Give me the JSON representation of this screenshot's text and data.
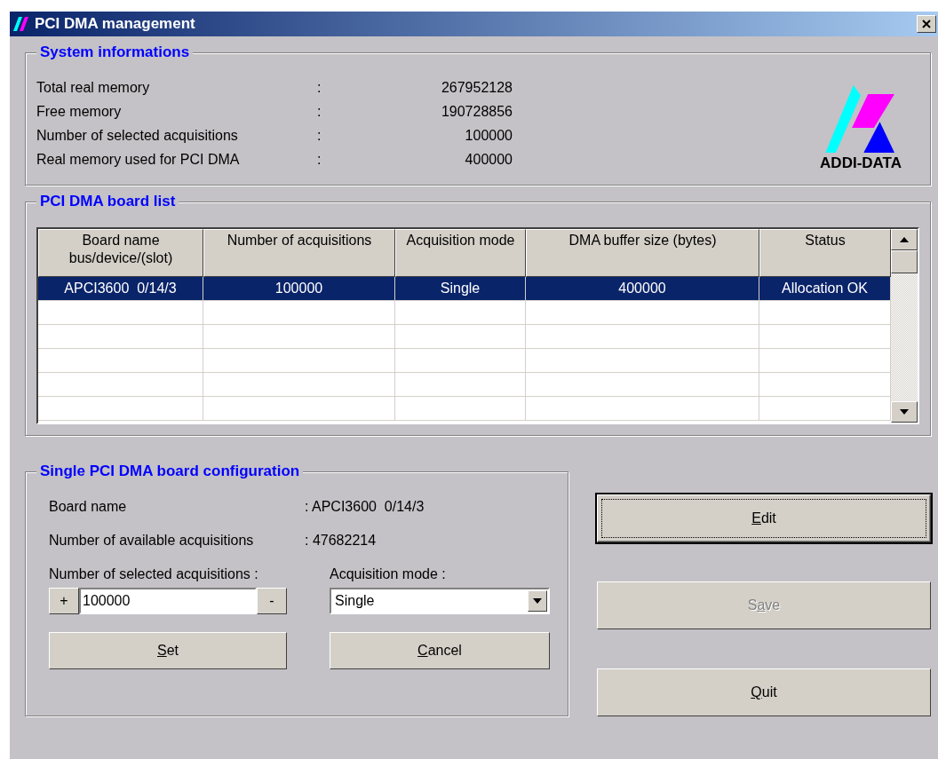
{
  "window": {
    "title": "PCI DMA management"
  },
  "system_info": {
    "title": "System informations",
    "rows": [
      {
        "label": "Total real memory",
        "separator": ":",
        "value": "267952128"
      },
      {
        "label": "Free memory",
        "separator": ":",
        "value": "190728856"
      },
      {
        "label": "Number of selected acquisitions",
        "separator": ":",
        "value": "100000"
      },
      {
        "label": "Real memory used for PCI DMA",
        "separator": ":",
        "value": "400000"
      }
    ],
    "logo": {
      "text": "ADDI-DATA"
    }
  },
  "board_list": {
    "title": "PCI DMA board list",
    "columns": [
      "Board name\nbus/device/(slot)",
      "Number of acquisitions",
      "Acquisition mode",
      "DMA buffer size (bytes)",
      "Status"
    ],
    "rows": [
      {
        "cells": [
          "APCI3600  0/14/3",
          "100000",
          "Single",
          "400000",
          "Allocation OK"
        ],
        "selected": true
      }
    ]
  },
  "config": {
    "title": "Single PCI DMA board configuration",
    "fields": [
      {
        "label": "Board name",
        "value": ": APCI3600  0/14/3"
      },
      {
        "label": "Number of available acquisitions",
        "value": ": 47682214"
      }
    ],
    "acquisitions": {
      "label": "Number of selected acquisitions :",
      "value": "100000",
      "plus": "+",
      "minus": "-"
    },
    "mode": {
      "label": "Acquisition mode :",
      "value": "Single"
    },
    "buttons": [
      {
        "mnemonic": "S",
        "after": "et",
        "disabled": false
      },
      {
        "mnemonic": "C",
        "after": "ancel",
        "disabled": false
      }
    ]
  },
  "actions": [
    {
      "mnemonic": "E",
      "after": "dit",
      "disabled": false,
      "focused": true
    },
    {
      "before": "S",
      "mnemonic": "a",
      "after": "ve",
      "disabled": true,
      "focused": false
    },
    {
      "mnemonic": "Q",
      "after": "uit",
      "disabled": false,
      "focused": false
    }
  ]
}
